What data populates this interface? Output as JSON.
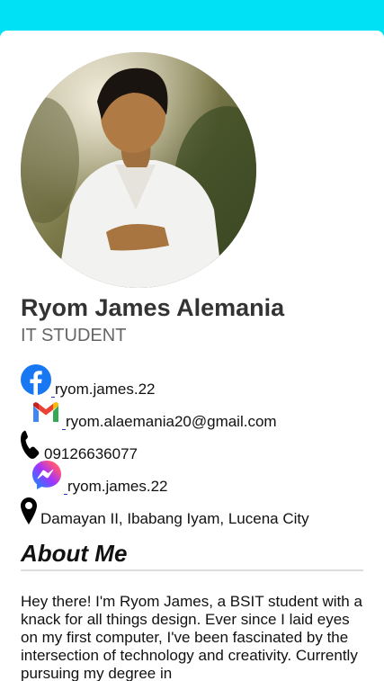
{
  "profile": {
    "name": "Ryom James Alemania",
    "role": "IT STUDENT"
  },
  "contacts": [
    {
      "icon": "facebook-icon",
      "text": "ryom.james.22"
    },
    {
      "icon": "gmail-icon",
      "text": "ryom.alaemania20@gmail.com"
    },
    {
      "icon": "phone-icon",
      "text": "09126636077"
    },
    {
      "icon": "messenger-icon",
      "text": "ryom.james.22"
    },
    {
      "icon": "location-pin-icon",
      "text": "Damayan II, Ibabang Iyam, Lucena City"
    }
  ],
  "about": {
    "title": "About Me",
    "text": "Hey there! I'm Ryom James, a BSIT student with a knack for all things design. Ever since I laid eyes on my first computer, I've been fascinated by the intersection of technology and creativity. Currently pursuing my degree in"
  },
  "colors": {
    "page_background": "#00e1f5",
    "card_background": "#ffffff",
    "facebook_blue": "#1877f2"
  }
}
